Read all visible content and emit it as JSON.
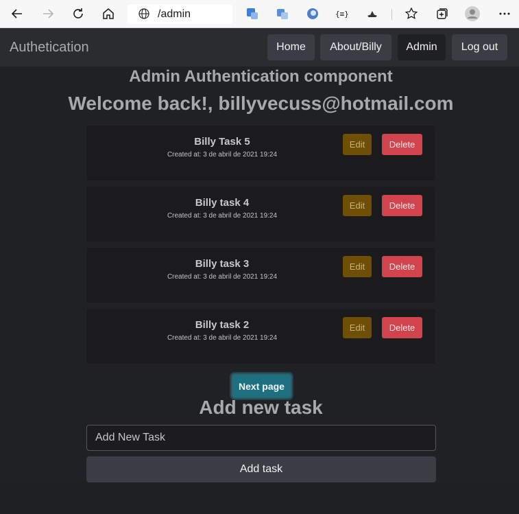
{
  "browser": {
    "url": "/admin"
  },
  "navbar": {
    "brand": "Authetication",
    "items": [
      {
        "label": "Home"
      },
      {
        "label": "About/Billy"
      },
      {
        "label": "Admin"
      },
      {
        "label": "Log out"
      }
    ],
    "active": "Admin"
  },
  "main": {
    "component_title": "Admin Authentication component",
    "welcome": "Welcome back!, billyvecuss@hotmail.com",
    "tasks": [
      {
        "title": "Billy Task 5",
        "created": "Created at: 3 de abril de 2021 19:24",
        "edit_label": "Edit",
        "delete_label": "Delete"
      },
      {
        "title": "Billy task 4",
        "created": "Created at: 3 de abril de 2021 19:24",
        "edit_label": "Edit",
        "delete_label": "Delete"
      },
      {
        "title": "Billy task 3",
        "created": "Created at: 3 de abril de 2021 19:24",
        "edit_label": "Edit",
        "delete_label": "Delete"
      },
      {
        "title": "Billy task 2",
        "created": "Created at: 3 de abril de 2021 19:24",
        "edit_label": "Edit",
        "delete_label": "Delete"
      }
    ],
    "next_page_label": "Next page",
    "add_heading": "Add new task",
    "input_placeholder": "Add New Task",
    "add_button_label": "Add task"
  },
  "colors": {
    "background": "#202124",
    "navbar": "#2b2c30",
    "edit_button": "#6e4f05",
    "delete_button": "#d1434d",
    "next_button": "#1e7080"
  }
}
